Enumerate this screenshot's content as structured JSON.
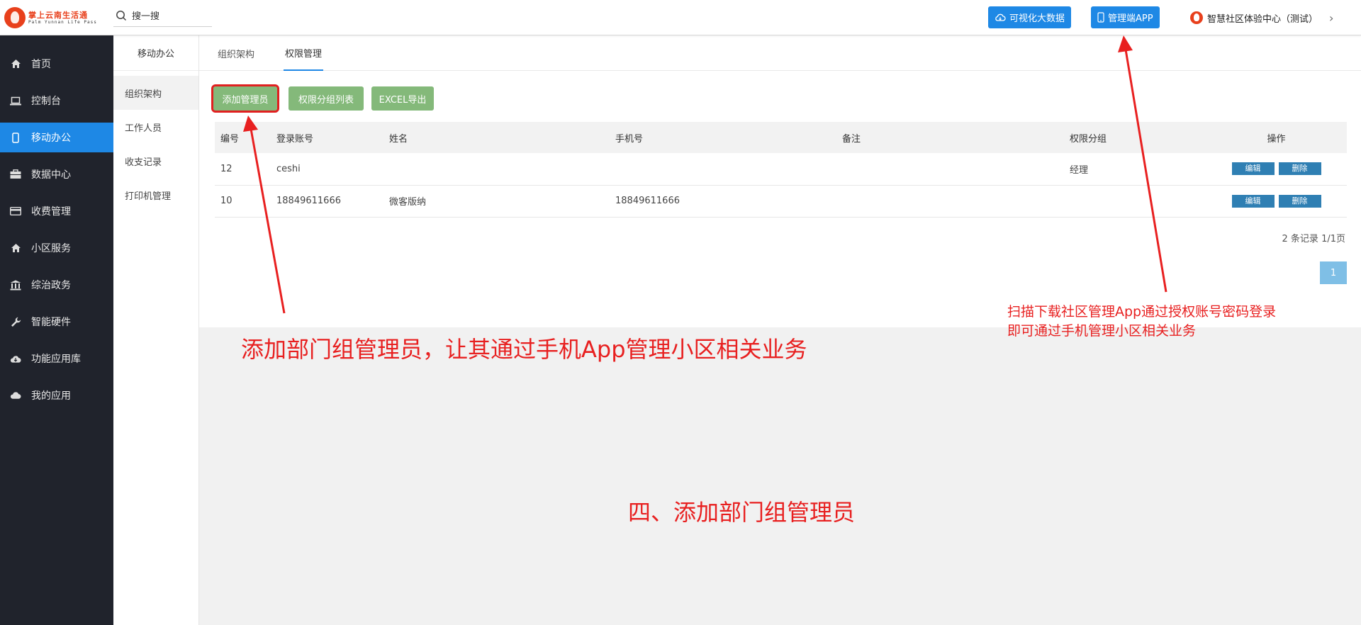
{
  "header": {
    "logo_text": "掌上云南生活通",
    "logo_sub": "Palm Yunnan Life Pass",
    "search_placeholder": "搜一搜",
    "btn_bigdata": "可视化大数据",
    "btn_app": "管理端APP",
    "org_name": "智慧社区体验中心（测试）",
    "chevron": "›"
  },
  "sidebar": {
    "items": [
      {
        "label": "首页",
        "icon": "home-icon"
      },
      {
        "label": "控制台",
        "icon": "laptop-icon"
      },
      {
        "label": "移动办公",
        "icon": "mobile-icon",
        "active": true
      },
      {
        "label": "数据中心",
        "icon": "briefcase-icon"
      },
      {
        "label": "收费管理",
        "icon": "card-icon"
      },
      {
        "label": "小区服务",
        "icon": "home-icon"
      },
      {
        "label": "综治政务",
        "icon": "bank-icon"
      },
      {
        "label": "智能硬件",
        "icon": "wrench-icon"
      },
      {
        "label": "功能应用库",
        "icon": "cloud-download-icon"
      },
      {
        "label": "我的应用",
        "icon": "cloud-icon"
      }
    ]
  },
  "submenu": {
    "title": "移动办公",
    "items": [
      "组织架构",
      "工作人员",
      "收支记录",
      "打印机管理"
    ]
  },
  "tabs": [
    "组织架构",
    "权限管理"
  ],
  "actions": {
    "add_admin": "添加管理员",
    "group_list": "权限分组列表",
    "excel_export": "EXCEL导出"
  },
  "table": {
    "headers": [
      "编号",
      "登录账号",
      "姓名",
      "手机号",
      "备注",
      "权限分组",
      "操作"
    ],
    "rows": [
      {
        "id": "12",
        "account": "ceshi",
        "name": "",
        "phone": "",
        "note": "",
        "group": "经理"
      },
      {
        "id": "10",
        "account": "18849611666",
        "name": "微客版纳",
        "phone": "18849611666",
        "note": "",
        "group": ""
      }
    ],
    "edit_label": "编辑",
    "delete_label": "删除"
  },
  "pagination": {
    "summary": "2 条记录 1/1页",
    "current_page": "1"
  },
  "annotations": {
    "left": "添加部门组管理员，让其通过手机App管理小区相关业务",
    "right_line1": "扫描下载社区管理App通过授权账号密码登录",
    "right_line2": "即可通过手机管理小区相关业务",
    "center": "四、添加部门组管理员",
    "color": "#e82020"
  },
  "colors": {
    "sidebar_bg": "#20232c",
    "accent": "#1e88e5",
    "action_green": "#84b97a",
    "row_button": "#2f7fb3"
  }
}
